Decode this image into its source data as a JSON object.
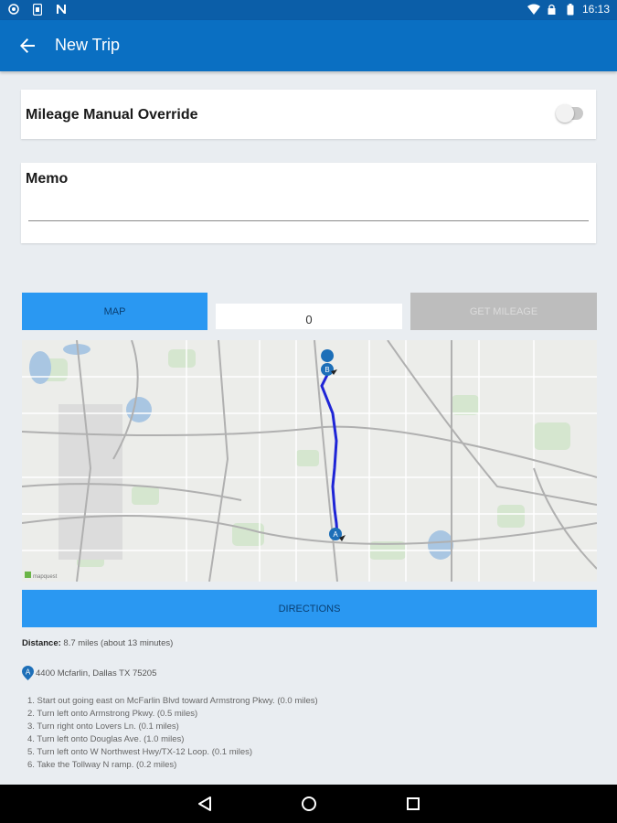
{
  "status_bar": {
    "time": "16:13",
    "left_icons": [
      "shield-icon",
      "sim-icon",
      "n-icon"
    ],
    "right_icons": [
      "wifi-icon",
      "lock-icon",
      "battery-icon"
    ]
  },
  "app_bar": {
    "back_icon": "arrow-back-icon",
    "title": "New Trip"
  },
  "override": {
    "label": "Mileage Manual Override",
    "toggle_on": false
  },
  "memo": {
    "label": "Memo",
    "value": "",
    "placeholder": ""
  },
  "actions": {
    "map_label": "MAP",
    "mileage_value": "0",
    "get_mileage_label": "GET MILEAGE",
    "directions_label": "DIRECTIONS"
  },
  "map": {
    "labels": {
      "start_marker": "A",
      "end_marker": "B",
      "attribution": "mapquest"
    },
    "route_color": "#1f25d6",
    "marker_color": "#1d6fb8"
  },
  "route": {
    "distance_label": "Distance:",
    "distance_value": "8.7 miles (about 13 minutes)",
    "origin_marker": "A",
    "origin": "4400 Mcfarlin, Dallas TX 75205",
    "steps": [
      "1. Start out going east on McFarlin Blvd toward Armstrong Pkwy. (0.0 miles)",
      "2. Turn left onto Armstrong Pkwy. (0.5 miles)",
      "3. Turn right onto Lovers Ln. (0.1 miles)",
      "4. Turn left onto Douglas Ave. (1.0 miles)",
      "5. Turn left onto W Northwest Hwy/TX-12 Loop. (0.1 miles)",
      "6. Take the Tollway N ramp. (0.2 miles)"
    ]
  },
  "nav_bar": {
    "icons": [
      "back-triangle-icon",
      "home-circle-icon",
      "recents-square-icon"
    ]
  },
  "colors": {
    "app_bar": "#0a6fc2",
    "status_bar": "#0b5ea8",
    "button_blue": "#2a98f2",
    "button_disabled": "#bdbdbd",
    "background": "#e9edf1"
  }
}
